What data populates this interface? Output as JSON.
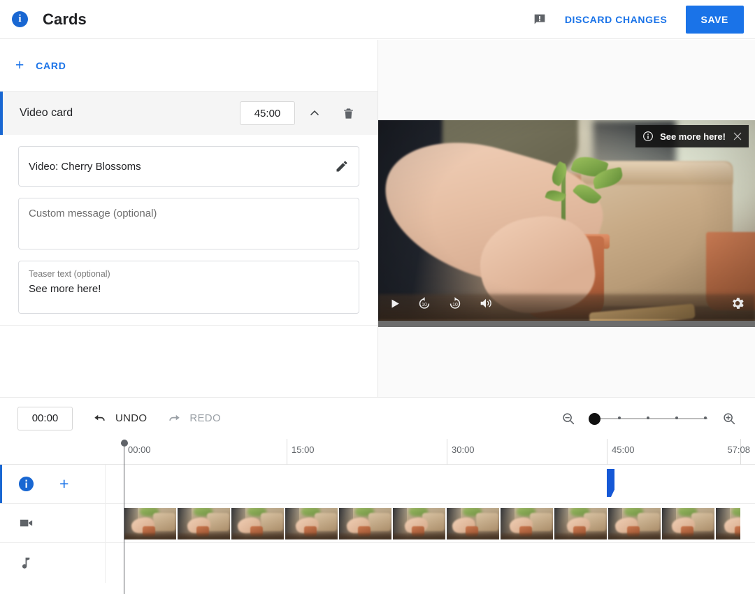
{
  "header": {
    "info_icon": "info-circle-icon",
    "title": "Cards",
    "feedback_icon": "feedback-speech-bubble-icon",
    "discard_label": "DISCARD CHANGES",
    "save_label": "SAVE",
    "accent_color": "#1a73e8",
    "save_bg": "#1a73e8"
  },
  "left_panel": {
    "add_card": {
      "plus": "+",
      "label": "CARD"
    },
    "card": {
      "accent_color": "#1967d2",
      "title": "Video card",
      "time": "45:00",
      "collapse_icon": "chevron-up-icon",
      "delete_icon": "trash-icon",
      "video_field": {
        "value": "Video: Cherry Blossoms",
        "edit_icon": "pencil-icon"
      },
      "custom_message": {
        "placeholder": "Custom message (optional)",
        "value": ""
      },
      "teaser_text": {
        "label": "Teaser text (optional)",
        "value": "See more here!"
      }
    }
  },
  "preview": {
    "teaser_overlay": {
      "info_icon": "info-circle-outline-icon",
      "text": "See more here!",
      "close_icon": "close-x-icon"
    },
    "controls": {
      "play": "play-icon",
      "rewind": "replay-10-icon",
      "forward": "forward-10-icon",
      "volume": "volume-on-icon",
      "settings": "gear-icon"
    }
  },
  "timeline_toolbar": {
    "current_time": "00:00",
    "undo": {
      "label": "UNDO",
      "icon": "undo-arrow-icon",
      "enabled": true
    },
    "redo": {
      "label": "REDO",
      "icon": "redo-arrow-icon",
      "enabled": false
    },
    "zoom_out_icon": "zoom-out-magnifier-icon",
    "zoom_in_icon": "zoom-in-magnifier-icon",
    "zoom_level": 0,
    "zoom_ticks": 4
  },
  "timeline": {
    "ticks": [
      "00:00",
      "15:00",
      "30:00",
      "45:00"
    ],
    "duration_label": "57:08",
    "playhead_time": "00:00",
    "tracks": [
      {
        "name": "cards-track",
        "icon": "info-circle-icon",
        "add_icon": "plus-icon",
        "accent_color": "#1967d2"
      },
      {
        "name": "video-track",
        "icon": "video-camera-icon"
      },
      {
        "name": "audio-track",
        "icon": "music-note-icon"
      }
    ],
    "card_marker": {
      "time": "45:00",
      "color": "#1558d6"
    },
    "filmstrip_frames": 12
  }
}
